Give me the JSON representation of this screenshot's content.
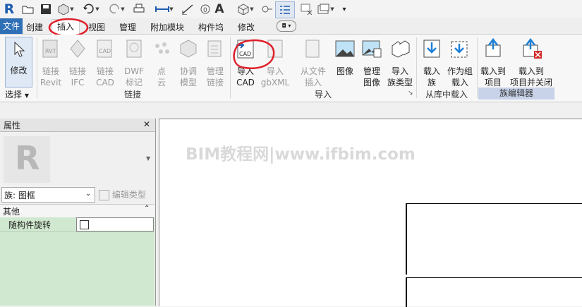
{
  "quick_access": {
    "icons": [
      "revit-logo-icon",
      "open-icon",
      "save-icon",
      "sync-icon",
      "undo-icon",
      "redo-icon",
      "print-icon",
      "measure-icon",
      "dimension-icon",
      "tag-icon",
      "text-icon",
      "3d-view-icon",
      "section-icon",
      "thin-lines-icon",
      "close-windows-icon",
      "switch-windows-icon",
      "customize-icon"
    ],
    "text_tool_label": "A"
  },
  "tabs": [
    "文件",
    "创建",
    "插入",
    "视图",
    "管理",
    "附加模块",
    "构件坞",
    "修改"
  ],
  "active_tab": "插入",
  "ribbon": {
    "modify": {
      "line1": "修改",
      "line2": ""
    },
    "select_panel": "选择",
    "link_buttons": [
      {
        "line1": "链接",
        "line2": "Revit"
      },
      {
        "line1": "链接",
        "line2": "IFC"
      },
      {
        "line1": "链接",
        "line2": "CAD"
      },
      {
        "line1": "DWF",
        "line2": "标记"
      },
      {
        "line1": "点",
        "line2": "云"
      },
      {
        "line1": "协调",
        "line2": "模型"
      },
      {
        "line1": "管理",
        "line2": "链接"
      }
    ],
    "link_panel": "链接",
    "import_buttons": [
      {
        "line1": "导入",
        "line2": "CAD"
      },
      {
        "line1": "导入",
        "line2": "gbXML"
      },
      {
        "line1": "从文件",
        "line2": "插入"
      },
      {
        "line1": "图像",
        "line2": ""
      },
      {
        "line1": "管理",
        "line2": "图像"
      },
      {
        "line1": "导入",
        "line2": "族类型"
      }
    ],
    "import_panel": "导入",
    "library_buttons": [
      {
        "line1": "载入",
        "line2": "族"
      },
      {
        "line1": "作为组",
        "line2": "载入"
      }
    ],
    "library_panel": "从库中载入",
    "family_editor_buttons": [
      {
        "line1": "载入到",
        "line2": "项目"
      },
      {
        "line1": "载入到",
        "line2": "项目并关闭"
      }
    ],
    "family_editor_panel": "族编辑器",
    "cad_badge": "CAD"
  },
  "properties": {
    "title": "属性",
    "close": "✕",
    "type_selector": "族: 图框",
    "edit_type": "编辑类型",
    "section": "其他",
    "param_name": "随构件旋转"
  },
  "watermark": "BIM教程网|www.ifbim.com",
  "colors": {
    "file_tab": "#2e6fb5",
    "annotation": "#e0202a",
    "panel_highlight": "#c8d3ea",
    "props_body": "#cfe8cf"
  }
}
